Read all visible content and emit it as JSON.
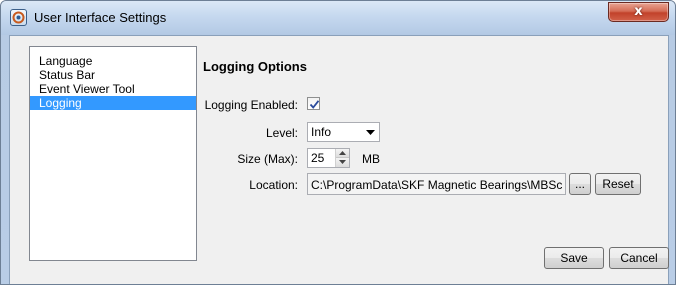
{
  "window": {
    "title": "User Interface Settings",
    "close_label": "x"
  },
  "nav": {
    "items": [
      "Language",
      "Status Bar",
      "Event Viewer Tool",
      "Logging"
    ],
    "selected": "Logging"
  },
  "logging": {
    "section_title": "Logging Options",
    "enabled_label": "Logging Enabled:",
    "enabled": true,
    "level_label": "Level:",
    "level_value": "Info",
    "size_label": "Size (Max):",
    "size_value": "25",
    "size_unit": "MB",
    "location_label": "Location:",
    "location_value": "C:\\ProgramData\\SKF Magnetic Bearings\\MBSc",
    "browse_label": "...",
    "reset_label": "Reset"
  },
  "footer": {
    "save_label": "Save",
    "cancel_label": "Cancel"
  },
  "colors": {
    "selection": "#3399ff",
    "close_button": "#c2422b"
  },
  "icons": {
    "app": "app-settings-icon",
    "checkmark": "check-icon",
    "dropdown": "chevron-down-icon",
    "spin_up": "spin-up-icon",
    "spin_down": "spin-down-icon"
  }
}
